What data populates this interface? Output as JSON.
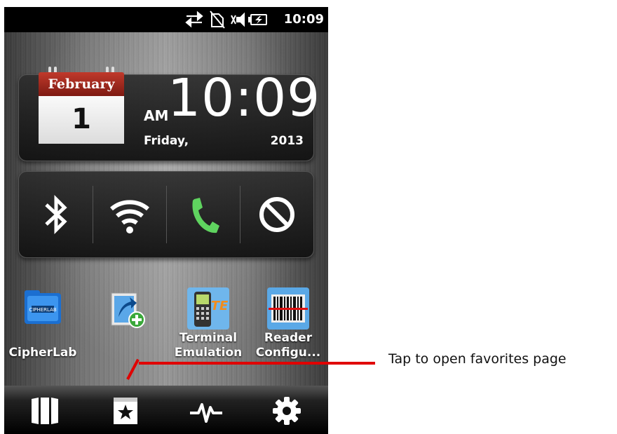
{
  "status_bar": {
    "time": "10:09",
    "icons": [
      "sync-arrows-icon",
      "no-sim-icon",
      "speaker-muted-icon",
      "battery-charging-icon"
    ]
  },
  "clock_widget": {
    "month": "February",
    "day_number": "1",
    "am_pm": "AM",
    "time": "10:09",
    "weekday": "Friday,",
    "year": "2013"
  },
  "toggles": [
    {
      "name": "bluetooth",
      "icon": "bluetooth-icon"
    },
    {
      "name": "wifi",
      "icon": "wifi-icon"
    },
    {
      "name": "phone",
      "icon": "phone-icon"
    },
    {
      "name": "do-not-disturb",
      "icon": "block-icon"
    }
  ],
  "apps": [
    {
      "label_lines": [
        "",
        "CipherLab"
      ],
      "icon": "cipherlab-folder-icon"
    },
    {
      "label_lines": [
        "",
        ""
      ],
      "icon": "add-shortcut-icon"
    },
    {
      "label_lines": [
        "Terminal",
        "Emulation"
      ],
      "icon": "terminal-emulation-icon"
    },
    {
      "label_lines": [
        "Reader",
        "Configu..."
      ],
      "icon": "barcode-reader-icon"
    }
  ],
  "bottom_nav": [
    {
      "name": "apps",
      "icon": "apps-panel-icon"
    },
    {
      "name": "favorites",
      "icon": "favorites-star-icon"
    },
    {
      "name": "activity",
      "icon": "pulse-icon"
    },
    {
      "name": "settings",
      "icon": "gear-icon"
    }
  ],
  "callout": {
    "text": "Tap to open favorites page",
    "color": "#e00000"
  },
  "colors": {
    "calendar_red": "#a8291d",
    "phone_green": "#5fd35f"
  }
}
